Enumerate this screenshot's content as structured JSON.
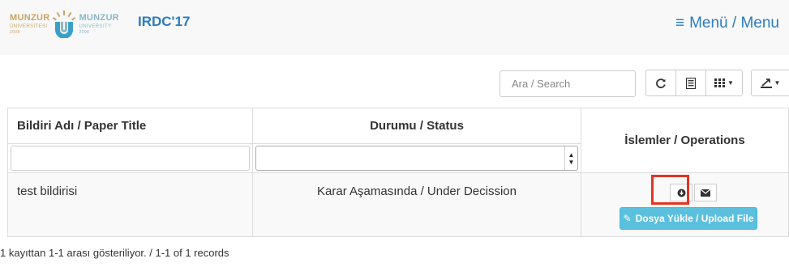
{
  "header": {
    "logo_left_title": "MUNZUR",
    "logo_left_sub": "ÜNİVERSİTESİ",
    "logo_left_year": "2008",
    "logo_right_title": "MUNZUR",
    "logo_right_sub": "UNIVERSITY",
    "logo_right_year": "2008",
    "brand": "IRDC'17",
    "menu_label": "Menü / Menu",
    "menu_icon": "hamburger-icon"
  },
  "toolbar": {
    "search_placeholder": "Ara / Search",
    "search_value": "",
    "refresh_icon": "refresh-icon",
    "toggle_view_icon": "list-view-icon",
    "columns_icon": "grid-columns-icon",
    "export_icon": "download-icon"
  },
  "table": {
    "columns": [
      "Bildiri Adı / Paper Title",
      "Durumu / Status",
      "İslemler / Operations"
    ],
    "filters": {
      "title_value": "",
      "status_selected": ""
    },
    "rows": [
      {
        "title": "test bildirisi",
        "status": "Karar Aşamasında / Under Decission"
      }
    ],
    "operations": {
      "view_icon": "circle-arrow-icon",
      "mail_icon": "envelope-icon",
      "upload_label": "Dosya Yükle / Upload File",
      "upload_icon": "edit-icon"
    }
  },
  "footer": {
    "records_text": "1 kayıttan 1-1 arası gösteriliyor. / 1-1 of 1 records"
  },
  "colors": {
    "brand_blue": "#2c7cc0",
    "upload_button": "#5bc0de",
    "highlight": "#e53322",
    "header_bg": "#f8f8f8"
  }
}
